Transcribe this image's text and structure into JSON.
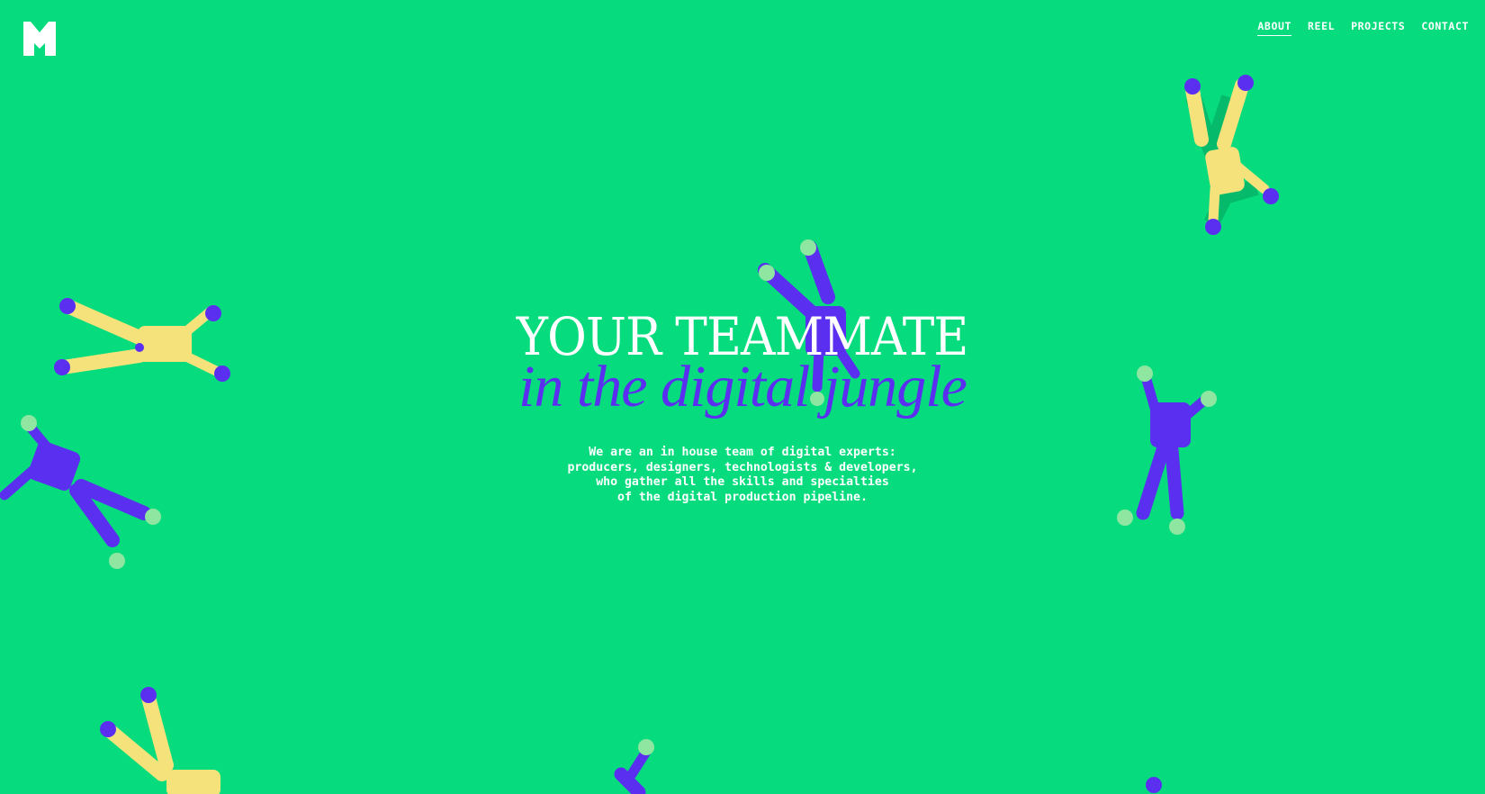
{
  "header": {
    "logo_icon": "m-logo-icon",
    "nav": [
      {
        "label": "ABOUT",
        "active": true
      },
      {
        "label": "REEL",
        "active": false
      },
      {
        "label": "PROJECTS",
        "active": false
      },
      {
        "label": "CONTACT",
        "active": false
      }
    ]
  },
  "hero": {
    "title_line1": "YOUR TEAMMATE",
    "title_line2": "in the digital jungle",
    "description": "We are an in house team of digital experts:\nproducers, designers, technologists & developers,\nwho gather all the skills and specialties\nof the digital production pipeline."
  },
  "colors": {
    "background": "#06dc7e",
    "accent_purple": "#5b2ff0",
    "figure_yellow": "#f5e27a",
    "figure_green_ball": "#8ee6a0"
  }
}
